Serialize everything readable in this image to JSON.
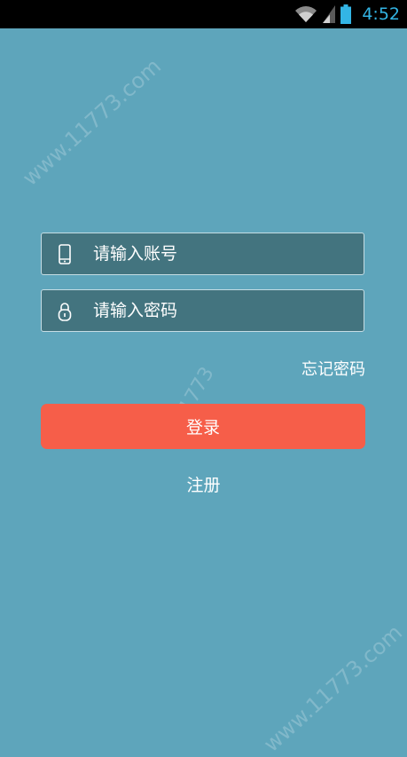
{
  "status_bar": {
    "time": "4:52",
    "wifi_icon": "wifi-icon",
    "signal_icon": "signal-icon",
    "battery_icon": "battery-icon"
  },
  "login_form": {
    "account_placeholder": "请输入账号",
    "password_placeholder": "请输入密码",
    "account_icon": "phone-icon",
    "password_icon": "lock-icon",
    "forgot_password": "忘记密码",
    "login_button": "登录",
    "register": "注册"
  },
  "watermark": "www.11773.com",
  "colors": {
    "background": "#5ea5bb",
    "field_background": "#43747f",
    "login_button": "#f65e49",
    "status_time": "#33b5e5"
  }
}
